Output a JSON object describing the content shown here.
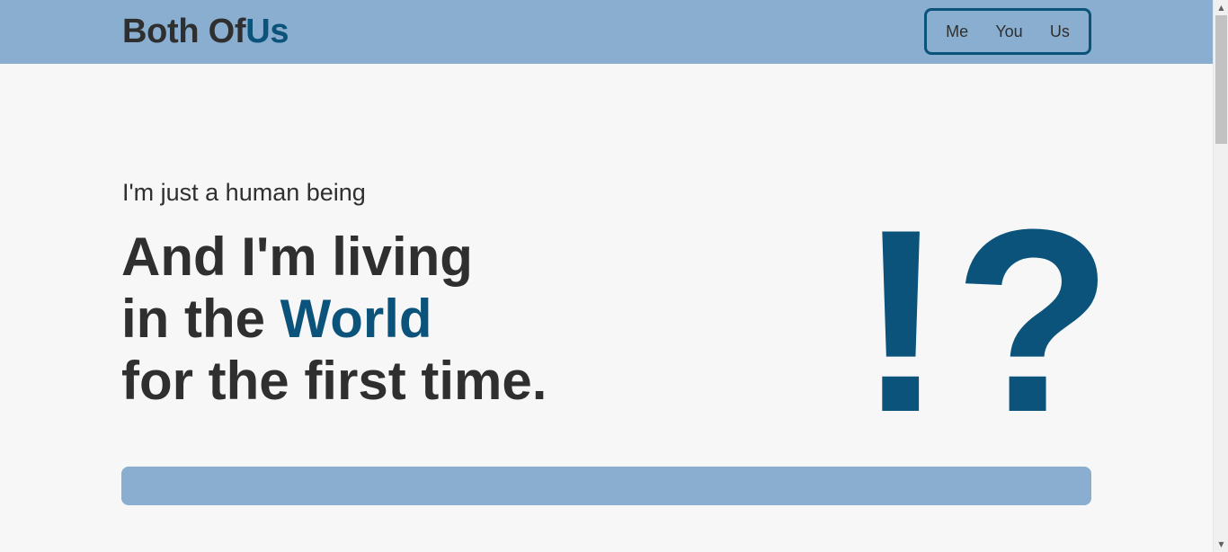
{
  "header": {
    "brand_main": "Both Of",
    "brand_accent": "Us",
    "nav": [
      {
        "label": "Me"
      },
      {
        "label": "You"
      },
      {
        "label": "Us"
      }
    ]
  },
  "hero": {
    "kicker": "I'm just a human being",
    "line1": "And I'm living",
    "line2_prefix": "in the ",
    "line2_accent": "World",
    "line3": "for the first time.",
    "symbol": "!?"
  },
  "colors": {
    "accent": "#0b537a",
    "bar": "#89aed0",
    "background": "#f7f7f7",
    "text": "#2f2f2f"
  },
  "icons": {
    "scroll_up": "scroll-up-arrow-icon",
    "scroll_down": "scroll-down-arrow-icon"
  }
}
